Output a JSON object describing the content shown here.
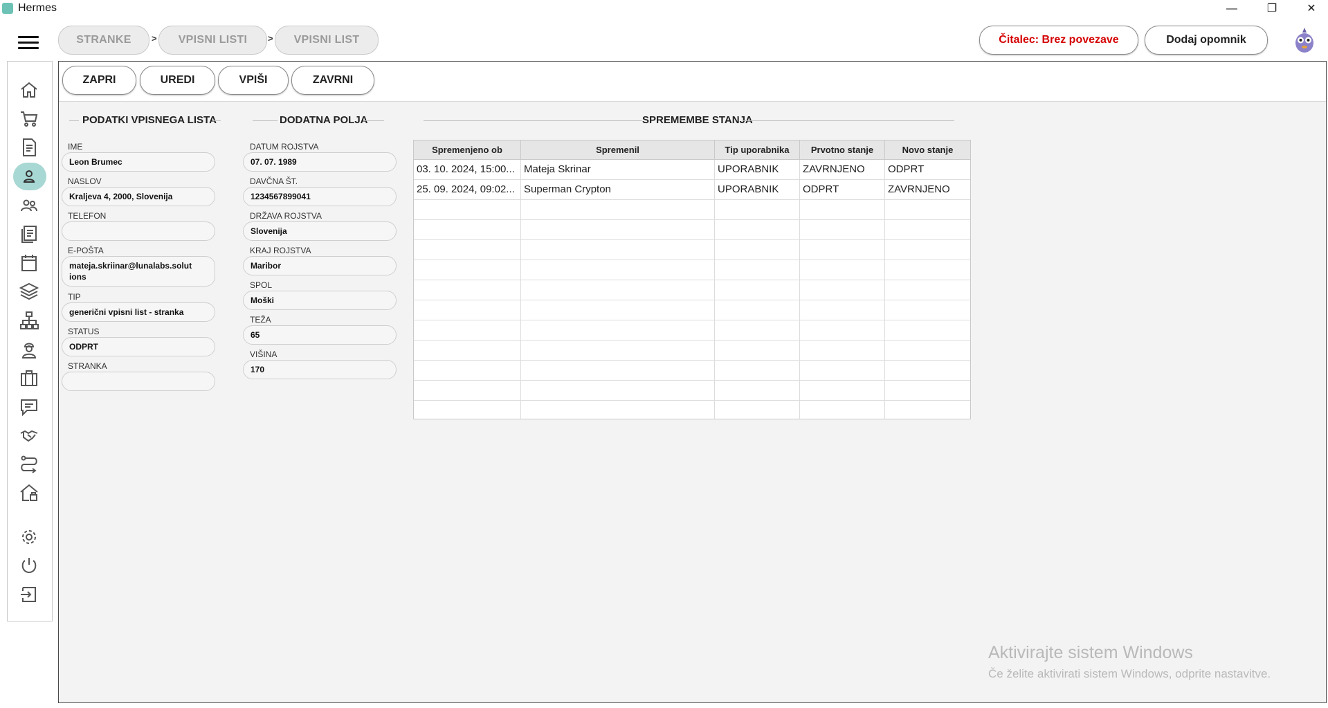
{
  "window": {
    "title": "Hermes",
    "controls": [
      "—",
      "❐",
      "✕"
    ]
  },
  "breadcrumb": [
    "STRANKE",
    "VPISNI LISTI",
    "VPISNI LIST"
  ],
  "breadcrumb_separator": ">",
  "header": {
    "reader_status": "Čitalec: Brez povezave",
    "add_reminder": "Dodaj opomnik"
  },
  "sidebar": {
    "items": [
      {
        "icon": "home-icon"
      },
      {
        "icon": "cart-icon"
      },
      {
        "icon": "document-icon"
      },
      {
        "icon": "person-icon",
        "active": true
      },
      {
        "icon": "people-icon"
      },
      {
        "icon": "list-icon"
      },
      {
        "icon": "calendar-icon"
      },
      {
        "icon": "layers-icon"
      },
      {
        "icon": "network-icon"
      },
      {
        "icon": "worker-icon"
      },
      {
        "icon": "briefcase-icon"
      },
      {
        "icon": "chat-icon"
      },
      {
        "icon": "handshake-icon"
      },
      {
        "icon": "route-icon"
      },
      {
        "icon": "house-icon"
      },
      {
        "icon": "settings-icon"
      },
      {
        "icon": "power-icon"
      },
      {
        "icon": "logout-icon"
      }
    ]
  },
  "actions": [
    "ZAPRI",
    "UREDI",
    "VPIŠI",
    "ZAVRNI"
  ],
  "sections": {
    "data_title": "PODATKI VPISNEGA LISTA",
    "extra_title": "DODATNA POLJA",
    "changes_title": "SPREMEMBE STANJA"
  },
  "data_fields": [
    {
      "label": "IME",
      "value": "Leon Brumec"
    },
    {
      "label": "NASLOV",
      "value": "Kraljeva 4, 2000, Slovenija"
    },
    {
      "label": "TELEFON",
      "value": ""
    },
    {
      "label": "E-POŠTA",
      "value": "mateja.skriinar@lunalabs.solut ions"
    },
    {
      "label": "TIP",
      "value": "generični vpisni list - stranka"
    },
    {
      "label": "STATUS",
      "value": "ODPRT"
    },
    {
      "label": "STRANKA",
      "value": ""
    }
  ],
  "extra_fields": [
    {
      "label": "DATUM ROJSTVA",
      "value": "07. 07. 1989"
    },
    {
      "label": "DAVČNA ŠT.",
      "value": "1234567899041"
    },
    {
      "label": "DRŽAVA ROJSTVA",
      "value": "Slovenija"
    },
    {
      "label": "KRAJ ROJSTVA",
      "value": "Maribor"
    },
    {
      "label": "SPOL",
      "value": "Moški"
    },
    {
      "label": "TEŽA",
      "value": "65"
    },
    {
      "label": "VIŠINA",
      "value": "170"
    }
  ],
  "changes_table": {
    "columns": [
      "Spremenjeno ob",
      "Spremenil",
      "Tip uporabnika",
      "Prvotno stanje",
      "Novo stanje"
    ],
    "rows": [
      [
        "03. 10. 2024, 15:00...",
        "Mateja Skrinar",
        "UPORABNIK",
        "ZAVRNJENO",
        "ODPRT"
      ],
      [
        "25. 09. 2024, 09:02...",
        "Superman Crypton",
        "UPORABNIK",
        "ODPRT",
        "ZAVRNJENO"
      ]
    ]
  },
  "watermark": {
    "line1": "Aktivirajte sistem Windows",
    "line2": "Če želite aktivirati sistem Windows, odprite nastavitve."
  },
  "colors": {
    "accent": "#a8d8d3",
    "reader_status": "#d40000"
  }
}
